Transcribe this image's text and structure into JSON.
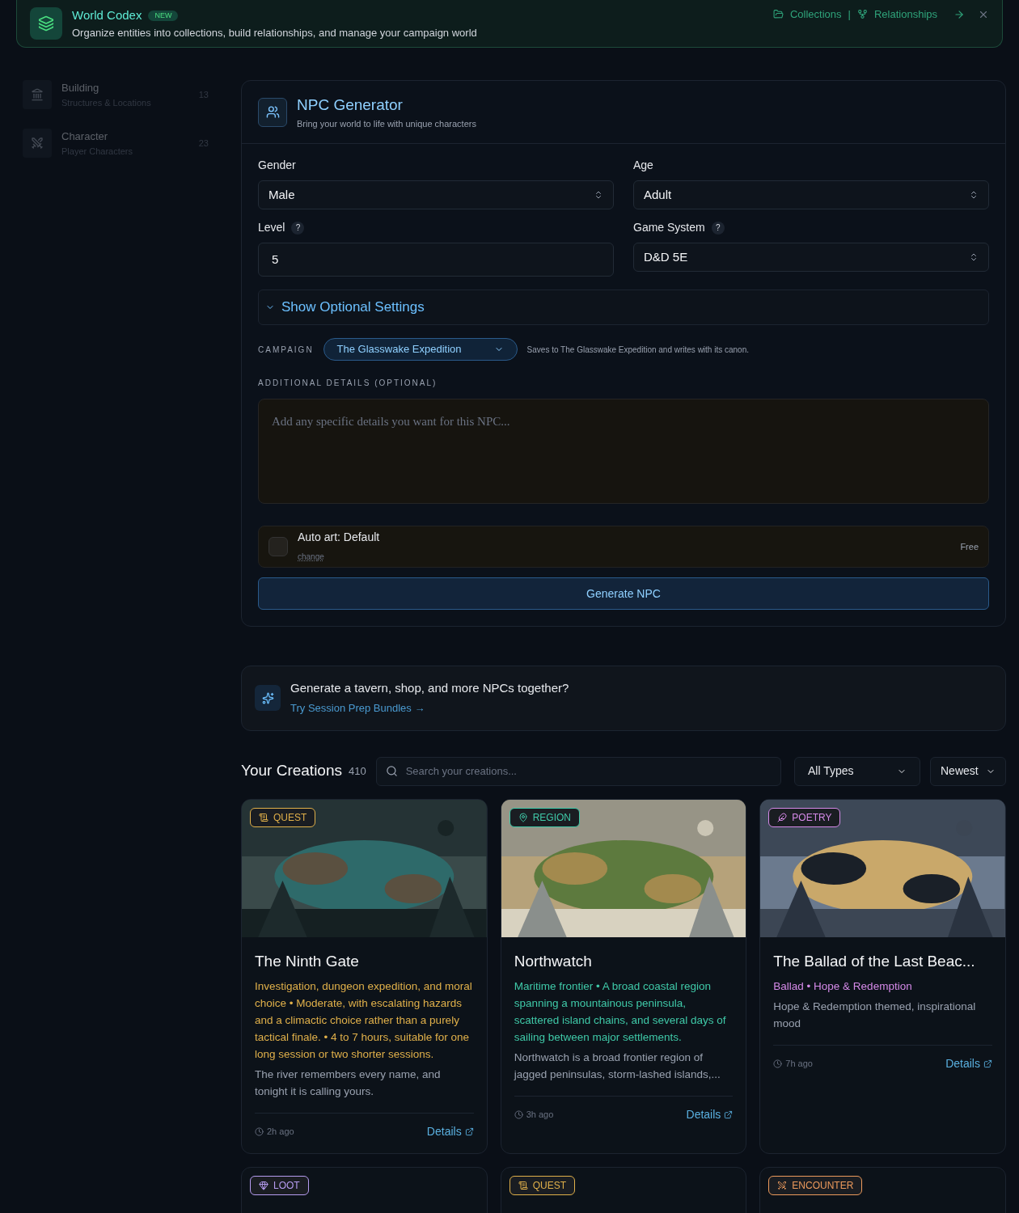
{
  "header": {
    "title": "World Codex",
    "badge": "NEW",
    "subtitle": "Organize entities into collections, build relationships, and manage your campaign world",
    "links": [
      "Collections",
      "Relationships"
    ],
    "separator": "|"
  },
  "sidebar": {
    "items": [
      {
        "kind": "building",
        "title": "Building",
        "subtitle": "Structures & Locations",
        "count": "13"
      },
      {
        "kind": "character",
        "title": "Character",
        "subtitle": "Player Characters",
        "count": "23"
      }
    ]
  },
  "generator": {
    "title": "NPC Generator",
    "subtitle": "Bring your world to life with unique characters",
    "fields": [
      {
        "kind": "select",
        "label": "Gender",
        "value": "Male"
      },
      {
        "kind": "select",
        "label": "Age",
        "value": "Adult"
      },
      {
        "kind": "input",
        "label": "Level",
        "help": "?",
        "value": "5"
      },
      {
        "kind": "select",
        "label": "Game System",
        "help": "?",
        "value": "D&D 5E"
      }
    ],
    "optional": {
      "label": "Show Optional Settings",
      "expanded": false
    },
    "campaign": {
      "label": "CAMPAIGN",
      "value": "The Glasswake Expedition",
      "note": "Saves to The Glasswake Expedition and writes with its canon."
    },
    "details": {
      "label": "ADDITIONAL DETAILS (OPTIONAL)",
      "placeholder": "Add any specific details you want for this NPC..."
    },
    "auto_art": {
      "label": "Auto art: Default",
      "link": "change",
      "price": "Free",
      "checked": false
    },
    "button": "Generate NPC"
  },
  "promo": {
    "text": "Generate a tavern, shop, and more NPCs together?",
    "link": "Try Session Prep Bundles →"
  },
  "creations": {
    "title": "Your Creations",
    "count": "410",
    "search": {
      "placeholder": "Search your creations..."
    },
    "filters": [
      "All Types",
      "Newest"
    ],
    "cards": [
      {
        "kind": "quest",
        "badge": "QUEST",
        "color": "#e0b04a",
        "title": "The Ninth Gate",
        "meta": "Investigation, dungeon expedition, and moral choice • Moderate, with escalating hazards and a climactic choice rather than a purely tactical finale. • 4 to 7 hours, suitable for one long session or two shorter sessions.",
        "description": "The river remembers every name, and tonight it is calling yours.",
        "time": "2h ago",
        "action": "Details"
      },
      {
        "kind": "region",
        "badge": "REGION",
        "color": "#3fc9a8",
        "title": "Northwatch",
        "meta": "Maritime frontier • A broad coastal region spanning a mountainous peninsula, scattered island chains, and several days of sailing between major settlements.",
        "description": "Northwatch is a broad frontier region of jagged peninsulas, storm-lashed islands,...",
        "time": "3h ago",
        "action": "Details"
      },
      {
        "kind": "poetry",
        "badge": "POETRY",
        "color": "#d58ae8",
        "title": "The Ballad of the Last Beac...",
        "meta": "Ballad • Hope & Redemption",
        "description": "Hope & Redemption themed, inspirational mood",
        "time": "7h ago",
        "action": "Details"
      },
      {
        "kind": "loot",
        "badge": "LOOT",
        "color": "#b69cf0"
      },
      {
        "kind": "quest",
        "badge": "QUEST",
        "color": "#e0b04a"
      },
      {
        "kind": "encounter",
        "badge": "ENCOUNTER",
        "color": "#ec9a5c"
      }
    ]
  }
}
